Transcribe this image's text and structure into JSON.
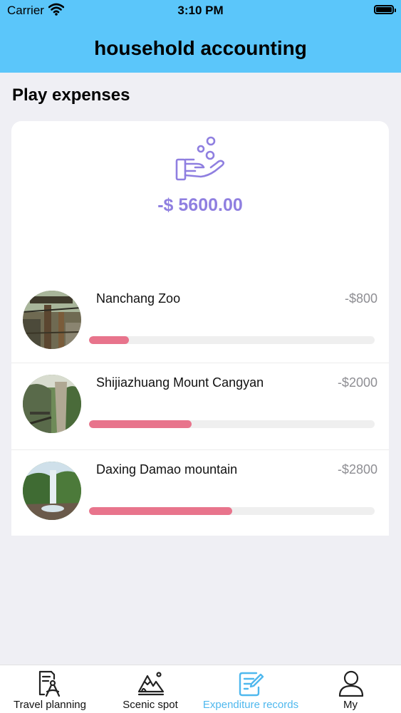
{
  "status_bar": {
    "carrier": "Carrier",
    "time": "3:10 PM"
  },
  "nav": {
    "title": "household accounting"
  },
  "section": {
    "title": "Play expenses"
  },
  "summary": {
    "total": "-$ 5600.00",
    "icon": "hand-coins-icon"
  },
  "items": [
    {
      "name": "Nanchang Zoo",
      "amount": "-$800",
      "progress": 0.14
    },
    {
      "name": "Shijiazhuang Mount Cangyan",
      "amount": "-$2000",
      "progress": 0.36
    },
    {
      "name": "Daxing Damao mountain",
      "amount": "-$2800",
      "progress": 0.5
    }
  ],
  "tabs": [
    {
      "label": "Travel planning",
      "icon": "travel-planning-icon"
    },
    {
      "label": "Scenic spot",
      "icon": "mountain-icon"
    },
    {
      "label": "Expenditure records",
      "icon": "edit-note-icon",
      "active": true
    },
    {
      "label": "My",
      "icon": "user-icon"
    }
  ],
  "colors": {
    "header": "#5bc6fa",
    "accent": "#8f7fe0",
    "progress": "#e8748c",
    "active_tab": "#4fb8ee"
  }
}
